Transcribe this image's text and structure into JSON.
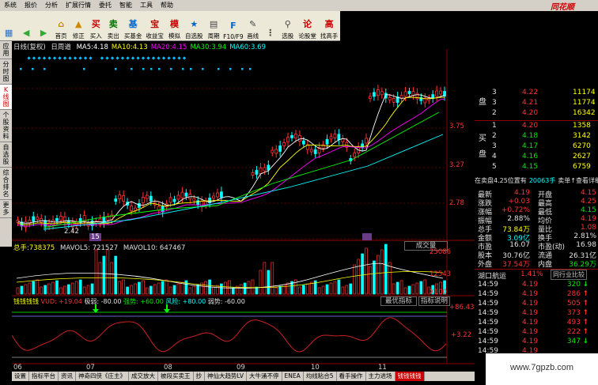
{
  "menu": [
    "系统",
    "报价",
    "分析",
    "扩展行情",
    "委托",
    "智能",
    "工具",
    "帮助"
  ],
  "brand": "同花顺",
  "toolbar": [
    {
      "label": "",
      "icon": "grid-icon",
      "color": "#2a6fd6",
      "sym": "▦"
    },
    {
      "label": "",
      "icon": "back-icon",
      "color": "#3a3",
      "sym": "◀"
    },
    {
      "label": "",
      "icon": "forward-icon",
      "color": "#3a3",
      "sym": "▶"
    },
    {
      "label": "首页",
      "icon": "home-icon",
      "color": "#c80",
      "sym": "⌂"
    },
    {
      "label": "修正",
      "icon": "up-arrow-icon",
      "color": "#c80",
      "sym": "▲"
    },
    {
      "label": "买入",
      "icon": "buy-icon",
      "color": "#c00",
      "sym": "买"
    },
    {
      "label": "卖出",
      "icon": "sell-icon",
      "color": "#070",
      "sym": "卖"
    },
    {
      "label": "买基金",
      "icon": "fund-icon",
      "color": "#06c",
      "sym": "基"
    },
    {
      "label": "收益宝",
      "icon": "treasure-icon",
      "color": "#c00",
      "sym": "宝"
    },
    {
      "label": "模拟",
      "icon": "sim-icon",
      "color": "#c00",
      "sym": "模"
    },
    {
      "label": "自选股",
      "icon": "star-icon",
      "color": "#06c",
      "sym": "★"
    },
    {
      "label": "周期",
      "icon": "period-icon",
      "color": "#444",
      "sym": "▤"
    },
    {
      "label": "F10/F9",
      "icon": "f10-icon",
      "color": "#06c",
      "sym": "F"
    },
    {
      "label": "画线",
      "icon": "pen-icon",
      "color": "#444",
      "sym": "✎"
    },
    {
      "label": "",
      "icon": "dots-icon",
      "color": "#444",
      "sym": "⋮"
    },
    {
      "label": "选股",
      "icon": "pick-icon",
      "color": "#444",
      "sym": "⚲"
    },
    {
      "label": "论股堂",
      "icon": "forum-icon",
      "color": "#c00",
      "sym": "论"
    },
    {
      "label": "找高手",
      "icon": "expert-icon",
      "color": "#c00",
      "sym": "高"
    }
  ],
  "left_tabs": [
    {
      "label": "应用",
      "active": false
    },
    {
      "label": "分时图",
      "active": false
    },
    {
      "label": "K线图",
      "active": true
    },
    {
      "label": "个股资料",
      "active": false
    },
    {
      "label": "自选股",
      "active": false
    },
    {
      "label": "综合排名",
      "active": false
    },
    {
      "label": "更多",
      "active": false
    }
  ],
  "chart_header": {
    "title": "日线(复权)",
    "mode": "日周道",
    "ma": [
      {
        "name": "MA5:",
        "value": "4.18",
        "color": "#ffffff"
      },
      {
        "name": "MA10:",
        "value": "4.13",
        "color": "#ffff00"
      },
      {
        "name": "MA20:",
        "value": "4.15",
        "color": "#ff00ff"
      },
      {
        "name": "MA30:",
        "value": "3.94",
        "color": "#00ff00"
      },
      {
        "name": "MA60:",
        "value": "3.69",
        "color": "#00ffff"
      }
    ]
  },
  "price_axis": [
    "3.75",
    "3.27",
    "2.78"
  ],
  "low_label": "2.42",
  "volume_header": {
    "label": "总手:",
    "value": "738375",
    "ma5": "MAVOL5: 721527",
    "ma10": "MAVOL10: 647467",
    "button": "成交量"
  },
  "volume_axis": [
    "25086",
    "12543",
    "X100"
  ],
  "indicator_header": {
    "name": "钱钱钱钱",
    "vud": "VUD: +19.04",
    "weak": "极弱: -80.00",
    "strong": "强势: +60.00",
    "risk": "风险: +80.00",
    "fade": "弱势: -60.00",
    "btn1": "最优指标",
    "btn2": "指标说明"
  },
  "indicator_axis": [
    "+86.43",
    "+3.22"
  ],
  "months": [
    "06",
    "07",
    "08",
    "09",
    "10",
    "11"
  ],
  "month_flag": "15",
  "order_book": {
    "sell": [
      {
        "lvl": "3",
        "price": "4.22",
        "vol": "11174"
      },
      {
        "lvl": "3",
        "price": "4.21",
        "vol": "11774"
      },
      {
        "lvl": "2",
        "price": "4.20",
        "vol": "16342"
      }
    ],
    "sell_label": "盘",
    "buy": [
      {
        "lvl": "1",
        "price": "4.20",
        "vol": "1358"
      },
      {
        "lvl": "2",
        "price": "4.18",
        "vol": "3142"
      },
      {
        "lvl": "3",
        "price": "4.17",
        "vol": "6270"
      },
      {
        "lvl": "4",
        "price": "4.16",
        "vol": "2627"
      },
      {
        "lvl": "5",
        "price": "4.15",
        "vol": "6759"
      }
    ],
    "buy_label1": "买",
    "buy_label2": "盘"
  },
  "status_line": {
    "left": "在卖盘4.25位置有",
    "mid": "20063手",
    "right": "卖单↑查看详细"
  },
  "stats": [
    {
      "k1": "最新",
      "v1": "4.19",
      "c1": "red",
      "k2": "开盘",
      "v2": "4.15",
      "c2": "red"
    },
    {
      "k1": "涨跌",
      "v1": "+0.03",
      "c1": "red",
      "k2": "最高",
      "v2": "4.25",
      "c2": "red"
    },
    {
      "k1": "涨幅",
      "v1": "+0.72%",
      "c1": "red",
      "k2": "最低",
      "v2": "4.15",
      "c2": "green"
    },
    {
      "k1": "振幅",
      "v1": "2.88%",
      "c1": "white",
      "k2": "均价",
      "v2": "4.19",
      "c2": "red"
    },
    {
      "k1": "总手",
      "v1": "73.84万",
      "c1": "yellow",
      "k2": "量比",
      "v2": "1.08",
      "c2": "red"
    },
    {
      "k1": "金额",
      "v1": "3.09亿",
      "c1": "cyan",
      "k2": "换手",
      "v2": "2.81%",
      "c2": "white"
    },
    {
      "k1": "市盈",
      "v1": "16.07",
      "c1": "white",
      "k2": "市盈(动)",
      "v2": "16.98",
      "c2": "white"
    },
    {
      "k1": "股本",
      "v1": "30.76亿",
      "c1": "white",
      "k2": "流通",
      "v2": "26.31亿",
      "c2": "white"
    },
    {
      "k1": "外盘",
      "v1": "37.54万",
      "c1": "red",
      "k2": "内盘",
      "v2": "36.29万",
      "c2": "green"
    }
  ],
  "sector": {
    "name": "湖口航运",
    "pct": "1.41%",
    "btn": "同行业比较"
  },
  "ticks": [
    {
      "t": "14:59",
      "p": "4.19",
      "v": "320",
      "d": "down"
    },
    {
      "t": "14:59",
      "p": "4.19",
      "v": "286",
      "d": "up"
    },
    {
      "t": "14:59",
      "p": "4.19",
      "v": "505",
      "d": "up"
    },
    {
      "t": "14:59",
      "p": "4.19",
      "v": "373",
      "d": "up"
    },
    {
      "t": "14:59",
      "p": "4.19",
      "v": "493",
      "d": "up"
    },
    {
      "t": "14:59",
      "p": "4.19",
      "v": "222",
      "d": "up"
    },
    {
      "t": "14:59",
      "p": "4.19",
      "v": "347",
      "d": "down"
    },
    {
      "t": "14:59",
      "p": "4.19",
      "v": "",
      "d": ""
    }
  ],
  "bottom_tabs": [
    {
      "label": "设置",
      "active": false
    },
    {
      "label": "指标平台",
      "active": false
    },
    {
      "label": "资讯",
      "active": false
    },
    {
      "label": "神奇四侠《庄主》",
      "active": false
    },
    {
      "label": "成交放大",
      "active": false
    },
    {
      "label": "被段买卖王",
      "active": false
    },
    {
      "label": "抄",
      "active": false
    },
    {
      "label": "神仙大趋势LV",
      "active": false
    },
    {
      "label": "大牛涌不停",
      "active": false
    },
    {
      "label": "ENEA",
      "active": false
    },
    {
      "label": "均线粘合5",
      "active": false
    },
    {
      "label": "看手操作",
      "active": false
    },
    {
      "label": "主力进场",
      "active": false
    },
    {
      "label": "钱钱钱钱",
      "active": true
    }
  ],
  "watermark": "www.7gpzb.com",
  "colors": {
    "up": "#ff3232",
    "down": "#00ffff",
    "grid": "#8b0000",
    "bg": "#000000"
  }
}
